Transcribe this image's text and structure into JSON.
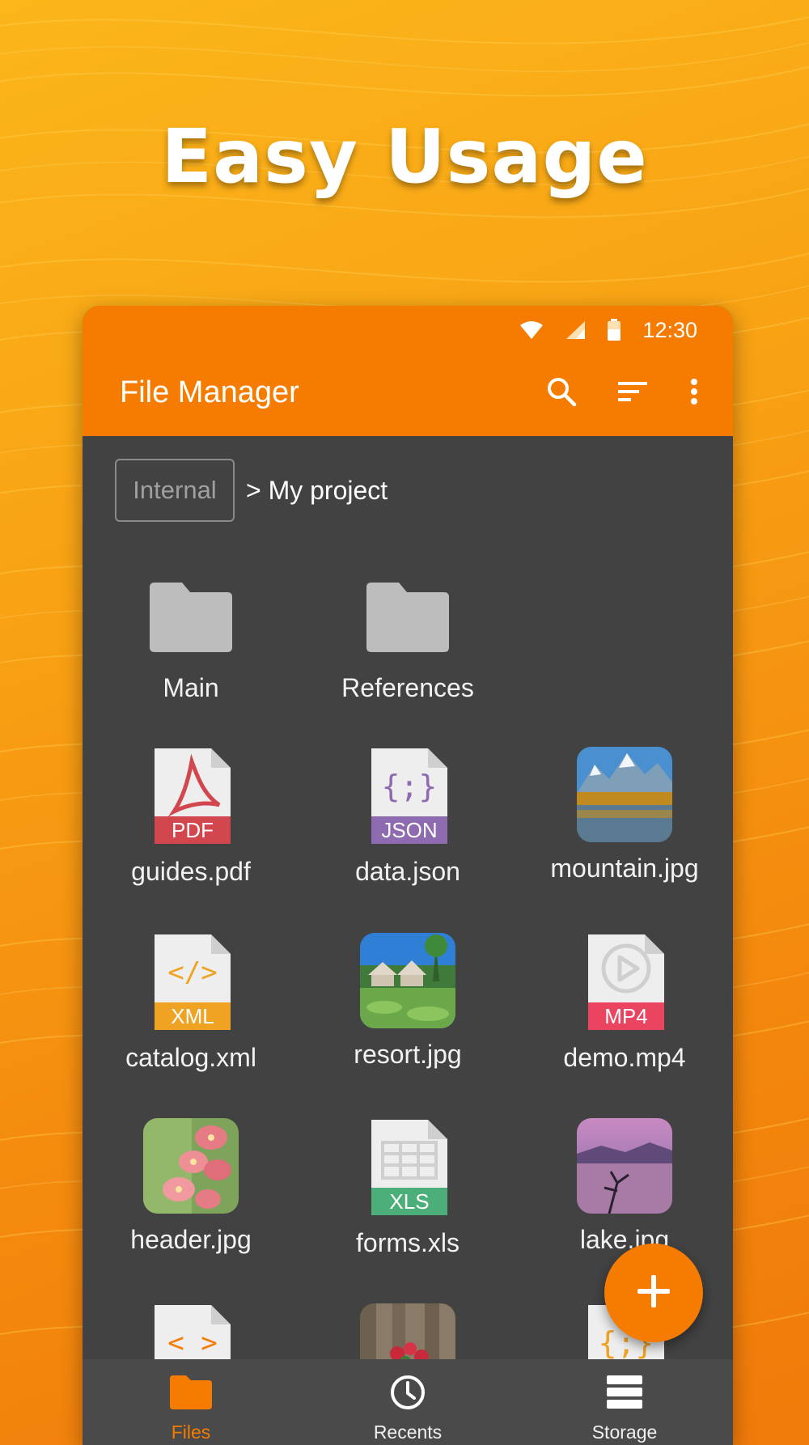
{
  "promo": {
    "title": "Easy Usage"
  },
  "status_bar": {
    "time": "12:30"
  },
  "app": {
    "title": "File Manager"
  },
  "icons": {
    "search": "search-icon",
    "sort": "sort-icon",
    "more": "more-vert-icon"
  },
  "breadcrumb": {
    "root": "Internal",
    "current": "> My project"
  },
  "folders": [
    {
      "name": "Main"
    },
    {
      "name": "References"
    }
  ],
  "files": [
    {
      "name": "guides.pdf",
      "badge": "PDF",
      "color": "#d2464d"
    },
    {
      "name": "data.json",
      "badge": "JSON",
      "color": "#8e6bb0"
    },
    {
      "name": "mountain.jpg"
    },
    {
      "name": "catalog.xml",
      "badge": "XML",
      "color": "#f0a223"
    },
    {
      "name": "resort.jpg"
    },
    {
      "name": "demo.mp4",
      "badge": "MP4",
      "color": "#ea4461"
    },
    {
      "name": "header.jpg"
    },
    {
      "name": "forms.xls",
      "badge": "XLS",
      "color": "#4caf7a"
    },
    {
      "name": "lake.jpg"
    }
  ],
  "bottom_nav": [
    {
      "label": "Files",
      "active": true
    },
    {
      "label": "Recents"
    },
    {
      "label": "Storage"
    }
  ],
  "colors": {
    "accent": "#f57c00",
    "surface": "#424242",
    "nav": "#4a4a4a"
  }
}
